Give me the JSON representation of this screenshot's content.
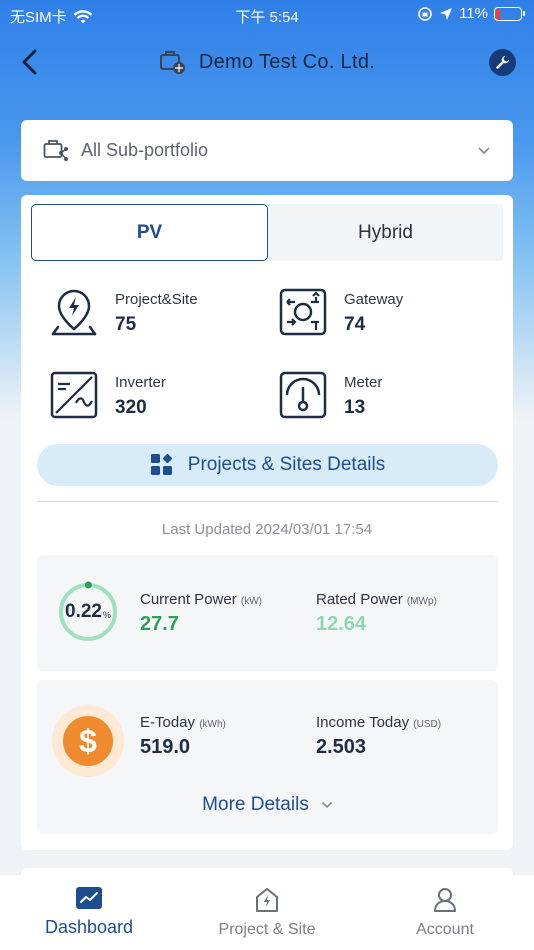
{
  "status_bar": {
    "carrier": "无SIM卡",
    "time": "下午 5:54",
    "battery": "11%"
  },
  "header": {
    "title": "Demo Test Co. Ltd."
  },
  "selector": {
    "label": "All Sub-portfolio"
  },
  "tabs": [
    {
      "label": "PV",
      "active": true
    },
    {
      "label": "Hybrid",
      "active": false
    }
  ],
  "stats": {
    "project_site": {
      "name": "Project&Site",
      "value": "75"
    },
    "gateway": {
      "name": "Gateway",
      "value": "74"
    },
    "inverter": {
      "name": "Inverter",
      "value": "320"
    },
    "meter": {
      "name": "Meter",
      "value": "13"
    }
  },
  "details_button": "Projects & Sites Details",
  "last_updated": "Last Updated 2024/03/01 17:54",
  "power": {
    "ratio": "0.22",
    "ratio_unit": "%",
    "ratio_fraction": 0.0022,
    "current_label": "Current Power",
    "current_unit": "(kW)",
    "current_value": "27.7",
    "rated_label": "Rated Power",
    "rated_unit": "(MWp)",
    "rated_value": "12.64"
  },
  "energy": {
    "today_label": "E-Today",
    "today_unit": "(kWh)",
    "today_value": "519.0",
    "income_label": "Income Today",
    "income_unit": "(USD)",
    "income_value": "2.503"
  },
  "more_details": "More Details",
  "nav": [
    {
      "label": "Dashboard",
      "active": true
    },
    {
      "label": "Project & Site",
      "active": false
    },
    {
      "label": "Account",
      "active": false
    }
  ],
  "colors": {
    "accent": "#1f4d8f",
    "green": "#2e9e5f",
    "light_green": "#8fd6b3",
    "orange": "#f08a2e"
  }
}
